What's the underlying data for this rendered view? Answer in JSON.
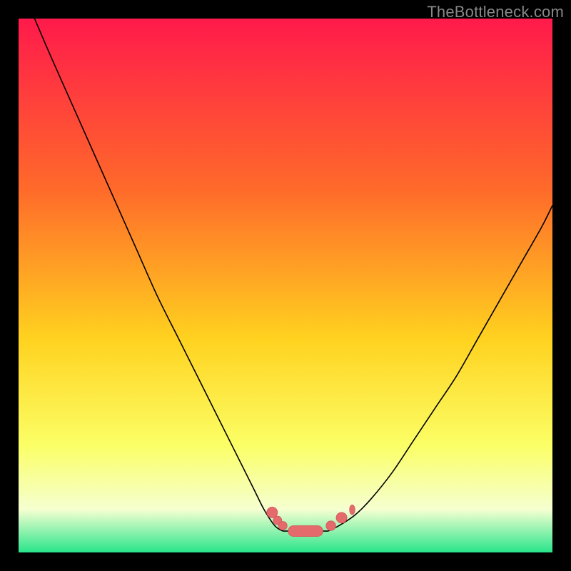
{
  "watermark": "TheBottleneck.com",
  "colors": {
    "frame": "#000000",
    "gradient_top": "#ff1a4b",
    "gradient_mid1": "#ff6a2a",
    "gradient_mid2": "#ffd21f",
    "gradient_mid3": "#fbff66",
    "gradient_bottom_light": "#f5ffd1",
    "gradient_bottom_green": "#29e58b",
    "curve": "#000000",
    "marker_fill": "#e46a6c",
    "marker_stroke": "#d85a5c"
  },
  "chart_data": {
    "type": "line",
    "title": "",
    "xlabel": "",
    "ylabel": "",
    "xlim": [
      0,
      100
    ],
    "ylim": [
      0,
      100
    ],
    "series": [
      {
        "name": "left-curve",
        "x": [
          3,
          6,
          10,
          14,
          18,
          22,
          26,
          30,
          34,
          38,
          41,
          44,
          46,
          48,
          49.5
        ],
        "values": [
          100,
          93,
          84,
          75,
          66,
          57,
          48,
          40,
          32,
          24,
          18,
          12,
          8,
          5,
          4
        ]
      },
      {
        "name": "right-curve",
        "x": [
          58,
          60,
          63,
          66,
          70,
          74,
          78,
          82,
          86,
          90,
          94,
          98,
          100
        ],
        "values": [
          4,
          5,
          7,
          10,
          15,
          21,
          27,
          33,
          40,
          47,
          54,
          61,
          65
        ]
      },
      {
        "name": "floor",
        "x": [
          49.5,
          58
        ],
        "values": [
          4,
          4
        ]
      }
    ],
    "markers": [
      {
        "shape": "circle",
        "x": 47.5,
        "y": 7.5,
        "r": 1.0
      },
      {
        "shape": "circle",
        "x": 48.5,
        "y": 6.0,
        "r": 0.8
      },
      {
        "shape": "circle",
        "x": 49.5,
        "y": 5.0,
        "r": 0.8
      },
      {
        "shape": "pill",
        "x1": 50.5,
        "x2": 57.0,
        "y": 4.0,
        "r": 1.0
      },
      {
        "shape": "circle",
        "x": 58.5,
        "y": 5.0,
        "r": 0.9
      },
      {
        "shape": "pill",
        "x1": 59.5,
        "x2": 61.5,
        "y": 6.5,
        "r": 1.0
      },
      {
        "shape": "pill",
        "x1": 62.0,
        "x2": 63.0,
        "y": 8.0,
        "r": 0.9
      }
    ],
    "annotations": []
  }
}
